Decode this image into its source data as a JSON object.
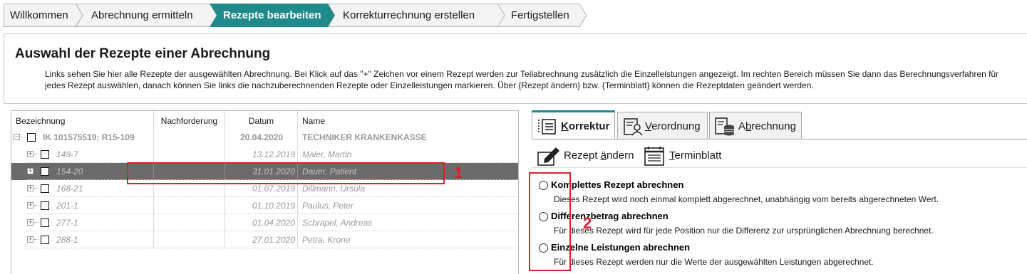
{
  "wizard": {
    "steps": [
      {
        "label": "Willkommen"
      },
      {
        "label": "Abrechnung ermitteln"
      },
      {
        "label": "Rezepte bearbeiten",
        "active": true
      },
      {
        "label": "Korrekturrechnung erstellen"
      },
      {
        "label": "Fertigstellen"
      }
    ],
    "active_color": "#1f8a8a"
  },
  "header": {
    "title": "Auswahl der Rezepte einer Abrechnung",
    "description": "Links sehen Sie hier alle Rezepte der ausgewählten Abrechnung. Bei Klick auf das \"+\" Zeichen vor einem Rezept werden zur Teilabrechnung zusätzlich die Einzelleistungen angezeigt. Im rechten Bereich müssen Sie dann das Berechnungsverfahren für jedes Rezept auswählen, danach können Sie links die nachzuberechnenden Rezepte oder Einzelleistungen markieren. Über {Rezept ändern} bzw. {Terminblatt} können die Rezeptdaten geändert werden."
  },
  "tree": {
    "columns": [
      "Bezeichnung",
      "Nachforderung",
      "Datum",
      "Name"
    ],
    "group": {
      "expander": "−",
      "label": "IK 101575519; R15-109",
      "nachforderung": "",
      "datum": "20.04.2020",
      "name": "TECHNIKER KRANKENKASSE"
    },
    "rows": [
      {
        "expander": "+",
        "label": "149-7",
        "nachforderung": "",
        "datum": "13.12.2019",
        "name": "Maler, Martin"
      },
      {
        "expander": "+",
        "label": "154-20",
        "nachforderung": "",
        "datum": "31.01.2020",
        "name": "Dauer, Patient",
        "selected": true
      },
      {
        "expander": "+",
        "label": "168-21",
        "nachforderung": "",
        "datum": "01.07.2019",
        "name": "Dillmann, Ursula"
      },
      {
        "expander": "+",
        "label": "201-1",
        "nachforderung": "",
        "datum": "01.10.2019",
        "name": "Paulus, Peter"
      },
      {
        "expander": "+",
        "label": "277-1",
        "nachforderung": "",
        "datum": "01.04.2020",
        "name": "Schrapel, Andreas"
      },
      {
        "expander": "+",
        "label": "288-1",
        "nachforderung": "",
        "datum": "27.01.2020",
        "name": "Petra, Krone"
      }
    ]
  },
  "annotations": {
    "marker1": "1",
    "marker2": "2",
    "color": "#e0202a"
  },
  "tabs": [
    {
      "label_pre": "",
      "label_ul": "K",
      "label_post": "orrektur",
      "icon": "list-columns-icon",
      "active": true
    },
    {
      "label_pre": "",
      "label_ul": "V",
      "label_post": "erordnung",
      "icon": "prescription-icon"
    },
    {
      "label_pre": "A",
      "label_ul": "b",
      "label_post": "rechnung",
      "icon": "database-icon"
    }
  ],
  "toolbar": {
    "edit_label_pre": "Rezept ",
    "edit_label_ul": "ä",
    "edit_label_post": "ndern",
    "edit_icon": "pencil-edit-icon",
    "schedule_label_ul": "T",
    "schedule_label_post": "erminblatt",
    "schedule_icon": "calendar-sheet-icon"
  },
  "options": [
    {
      "title": "Komplettes Rezept abrechnen",
      "desc": "Dieses Rezept wird noch einmal komplett abgerechnet, unabhängig vom bereits abgerechneten Wert."
    },
    {
      "title": "Differenzbetrag abrechnen",
      "desc": "Für dieses Rezept wird für jede Position nur die Differenz zur ursprünglichen Abrechnung berechnet."
    },
    {
      "title": "Einzelne Leistungen abrechnen",
      "desc": "Für dieses Rezept werden nur die Werte der ausgewählten Leistungen abgerechnet."
    }
  ]
}
